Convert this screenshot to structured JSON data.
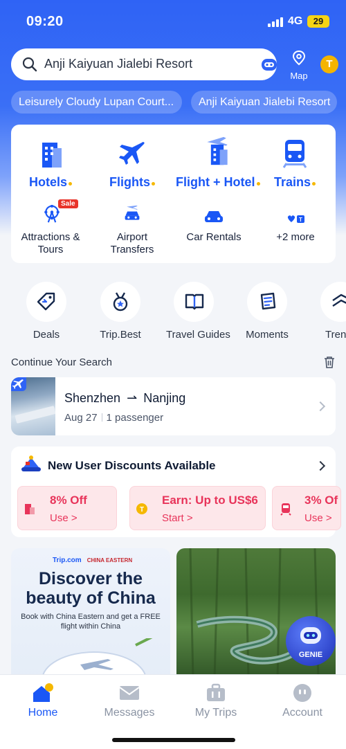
{
  "status": {
    "time": "09:20",
    "network": "4G",
    "battery": "29"
  },
  "search": {
    "query": "Anji Kaiyuan Jialebi Resort",
    "map_label": "Map",
    "avatar_letter": "T"
  },
  "recent_chips": [
    "Leisurely Cloudy Lupan Court...",
    "Anji Kaiyuan Jialebi Resort"
  ],
  "main_modules": [
    {
      "label": "Hotels",
      "icon": "hotel-icon"
    },
    {
      "label": "Flights",
      "icon": "flight-icon"
    },
    {
      "label": "Flight + Hotel",
      "icon": "flight-hotel-icon"
    },
    {
      "label": "Trains",
      "icon": "train-icon"
    }
  ],
  "sub_modules": [
    {
      "label": "Attractions & Tours",
      "icon": "ferris-wheel-icon"
    },
    {
      "label": "Airport Transfers",
      "icon": "airport-car-icon"
    },
    {
      "label": "Car Rentals",
      "icon": "car-icon"
    },
    {
      "label": "+2 more",
      "icon": "more-icon"
    }
  ],
  "sale_badge": "Sale",
  "quick_links": [
    {
      "label": "Deals",
      "icon": "tag-icon"
    },
    {
      "label": "Trip.Best",
      "icon": "medal-icon"
    },
    {
      "label": "Travel Guides",
      "icon": "book-icon"
    },
    {
      "label": "Moments",
      "icon": "notes-icon"
    },
    {
      "label": "Tren",
      "icon": "trend-icon"
    }
  ],
  "continue_search": {
    "title": "Continue Your Search",
    "route_from": "Shenzhen",
    "route_to": "Nanjing",
    "arrow": "⇀",
    "date": "Aug 27",
    "passengers": "1 passenger"
  },
  "promo": {
    "title": "New User Discounts Available",
    "coupons": [
      {
        "amount": "8% Off",
        "action": "Use >"
      },
      {
        "amount": "Earn: Up to US$6",
        "action": "Start >"
      },
      {
        "amount": "3% Of",
        "action": "Use >"
      }
    ]
  },
  "banners": {
    "left": {
      "brand": "Trip.com",
      "partner": "CHINA EASTERN",
      "title_line1": "Discover the",
      "title_line2": "beauty of China",
      "desc_line1": "Book with China Eastern and get a FREE",
      "desc_line2": "flight within China"
    }
  },
  "genie_label": "GENIE",
  "tabs": [
    {
      "label": "Home",
      "active": true
    },
    {
      "label": "Messages",
      "active": false
    },
    {
      "label": "My Trips",
      "active": false
    },
    {
      "label": "Account",
      "active": false
    }
  ],
  "colors": {
    "brand": "#2f63f5",
    "accent": "#1a57f5",
    "promo": "#e8345a",
    "dot": "#f5b800"
  }
}
